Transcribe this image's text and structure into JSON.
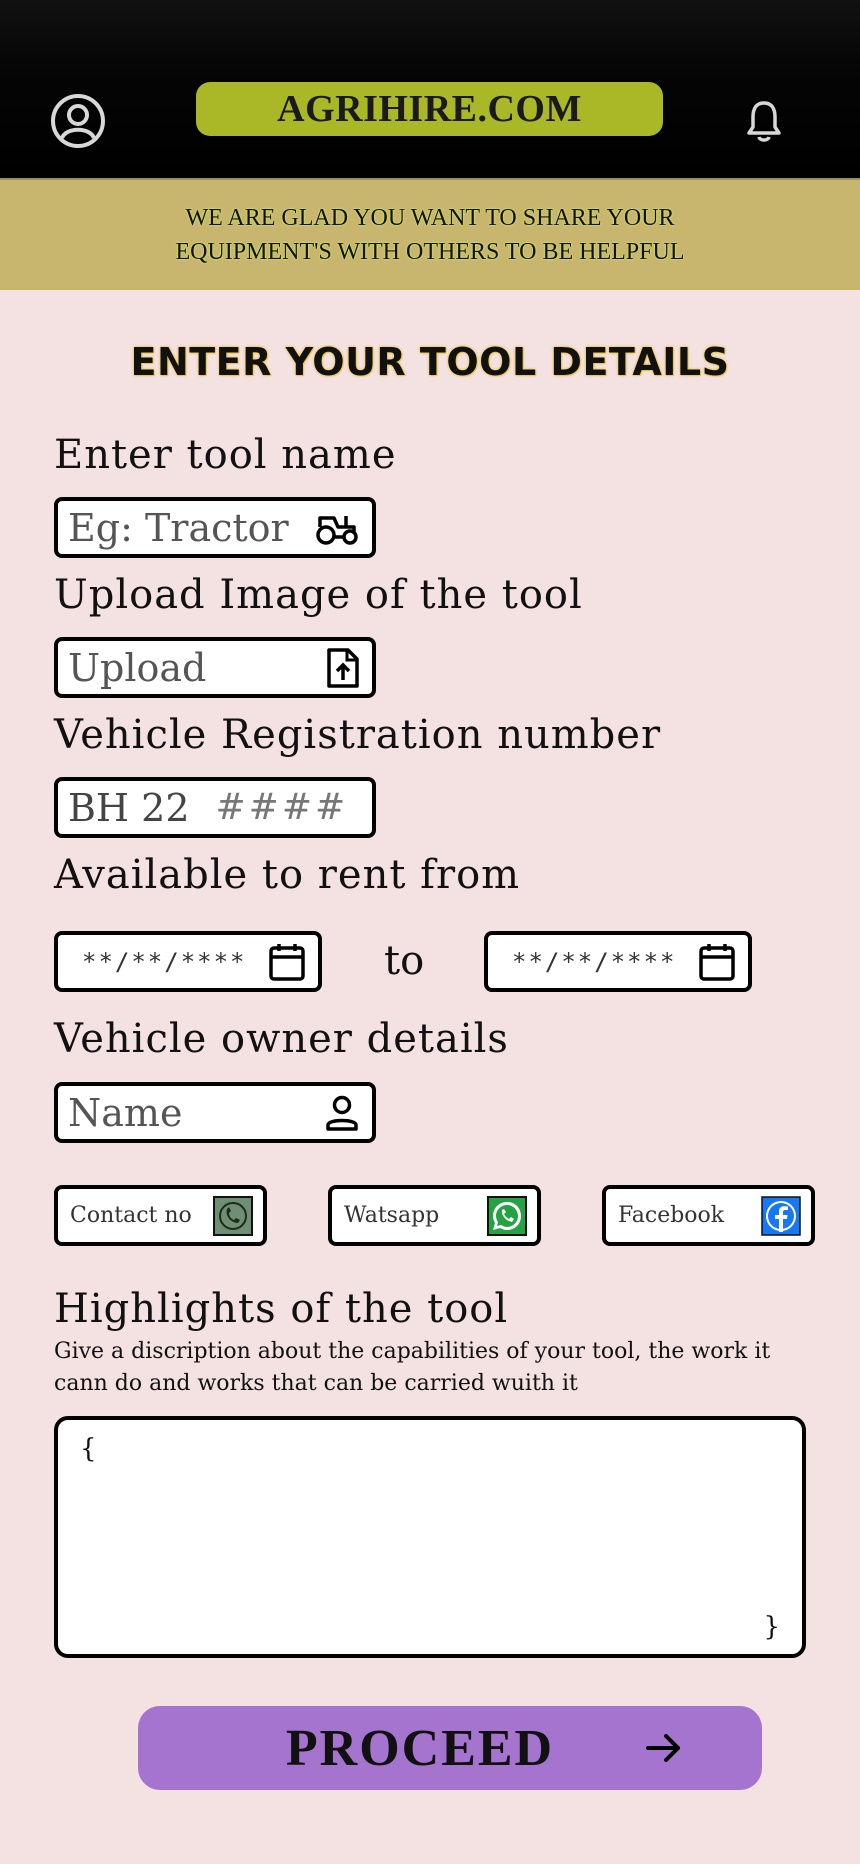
{
  "header": {
    "brand": "AGRIHIRE.COM",
    "profile_icon": "user-circle-icon",
    "notification_icon": "bell-icon"
  },
  "banner": {
    "line1": "WE ARE GLAD YOU WANT TO SHARE YOUR",
    "line2": "EQUIPMENT'S WITH OTHERS TO BE HELPFUL"
  },
  "form": {
    "title": "ENTER YOUR TOOL DETAILS",
    "tool_name": {
      "label": "Enter tool name",
      "placeholder": "Eg: Tractor",
      "icon": "tractor-icon"
    },
    "image": {
      "label": "Upload Image of the tool",
      "placeholder": "Upload",
      "icon": "file-upload-icon"
    },
    "registration": {
      "label": "Vehicle Registration number",
      "prefix": "BH 22",
      "placeholder": "####"
    },
    "availability": {
      "label": "Available to rent from",
      "from_placeholder": "**/**/****",
      "to_label": "to",
      "to_placeholder": "**/**/****",
      "icon": "calendar-icon"
    },
    "owner": {
      "label": "Vehicle owner details",
      "name_placeholder": "Name",
      "name_icon": "person-icon",
      "contact_label": "Contact no",
      "contact_icon": "phone-icon",
      "whatsapp_label": "Watsapp",
      "whatsapp_icon": "whatsapp-icon",
      "facebook_label": "Facebook",
      "facebook_icon": "facebook-icon"
    },
    "highlights": {
      "label": "Highlights of the tool",
      "hint": "Give a discription about the capabilities of your tool, the work it cann do and works that can be carried wuith it",
      "open_brace": "{",
      "close_brace": "}"
    },
    "proceed": {
      "label": "PROCEED",
      "icon": "arrow-right-icon"
    }
  },
  "colors": {
    "background": "#f4e1e2",
    "brand_pill": "#aab726",
    "banner": "#c8b66f",
    "proceed": "#a574cf",
    "facebook": "#1877f2",
    "whatsapp": "#25a244"
  }
}
